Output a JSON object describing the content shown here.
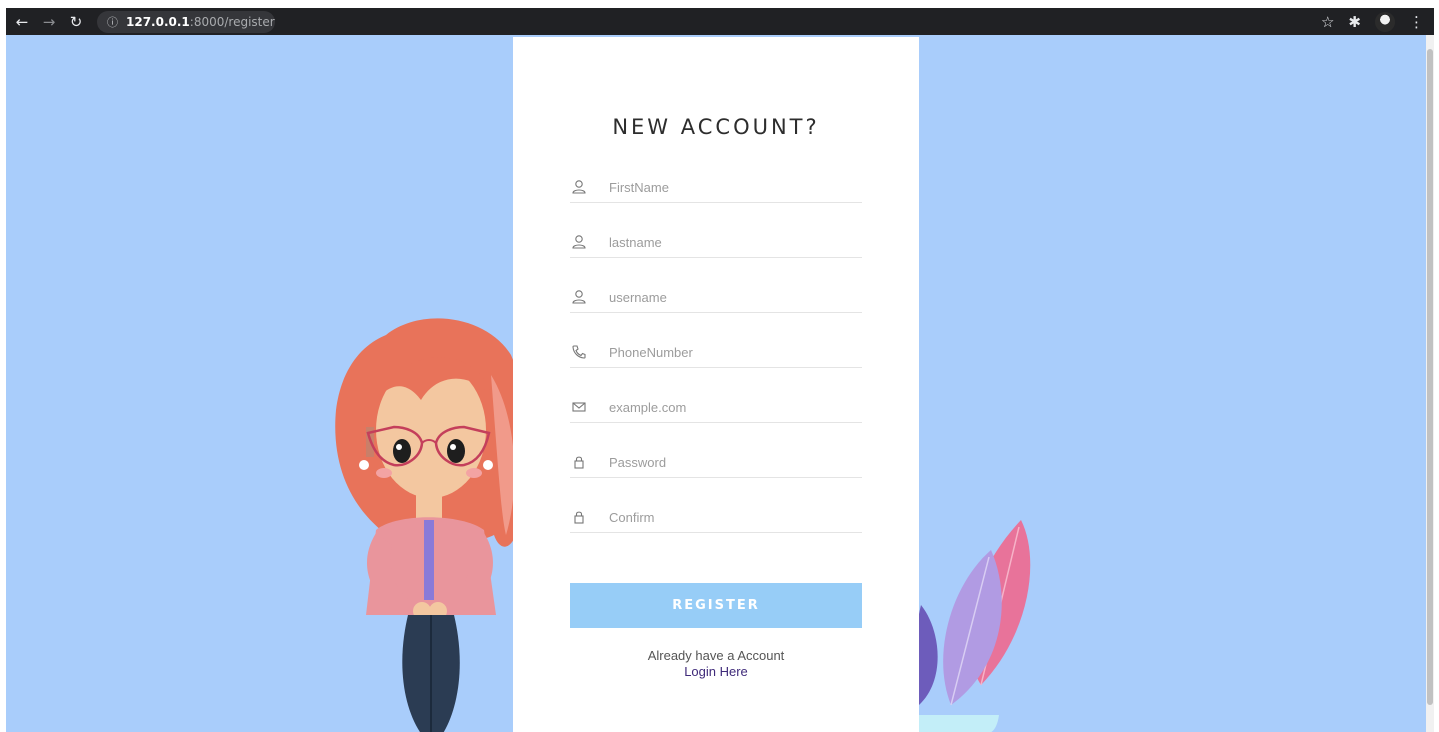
{
  "browser": {
    "url_host": "127.0.0.1",
    "url_path": ":8000/register",
    "icons": [
      "back-arrow-icon",
      "forward-arrow-icon",
      "reload-icon",
      "info-icon",
      "star-icon",
      "puzzle-icon",
      "menu-dots-icon"
    ]
  },
  "form": {
    "title": "NEW ACCOUNT?",
    "fields": [
      {
        "placeholder": "FirstName",
        "icon": "user-icon"
      },
      {
        "placeholder": "lastname",
        "icon": "user-icon"
      },
      {
        "placeholder": "username",
        "icon": "user-icon"
      },
      {
        "placeholder": "PhoneNumber",
        "icon": "phone-icon"
      },
      {
        "placeholder": "example.com",
        "icon": "mail-icon"
      },
      {
        "placeholder": "Password",
        "icon": "lock-icon"
      },
      {
        "placeholder": "Confirm",
        "icon": "lock-icon"
      }
    ],
    "register_label": "REGISTER",
    "already_text": "Already have a Account",
    "login_link": "Login Here"
  },
  "colors": {
    "background": "#a9cdfb",
    "button": "#97cdf7",
    "link": "#3f2a7a"
  }
}
